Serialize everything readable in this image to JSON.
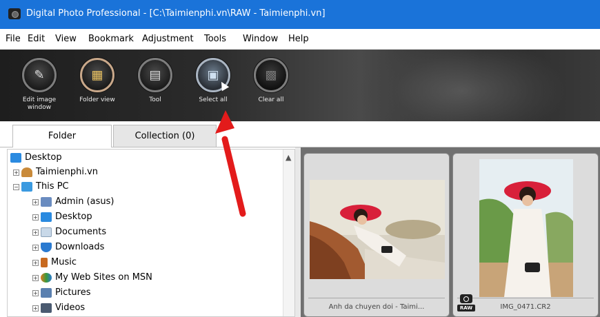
{
  "window": {
    "title": "Digital Photo Professional - [C:\\Taimienphi.vn\\RAW - Taimienphi.vn]"
  },
  "menu": [
    "File",
    "Edit",
    "View",
    "Bookmark",
    "Adjustment",
    "Tools",
    "Window",
    "Help"
  ],
  "toolbar": {
    "buttons": [
      {
        "label": "Edit image window",
        "icon": "edit-image-icon"
      },
      {
        "label": "Folder view",
        "icon": "folder-view-icon"
      },
      {
        "label": "Tool",
        "icon": "tool-palette-icon"
      },
      {
        "label": "Select all",
        "icon": "select-all-icon"
      },
      {
        "label": "Clear all",
        "icon": "clear-all-icon"
      }
    ]
  },
  "tabs": {
    "folder": "Folder",
    "collection": "Collection (0)"
  },
  "tree": [
    {
      "label": "Desktop",
      "icon": "desktop-icon",
      "color": "#2a8ae0"
    },
    {
      "label": "Taimienphi.vn",
      "icon": "user-folder-icon",
      "color": "#c98a3a"
    },
    {
      "label": "This PC",
      "icon": "computer-icon",
      "color": "#3a9ae0"
    },
    {
      "label": "Admin (asus)",
      "icon": "network-drive-icon",
      "color": "#6a8cc0"
    },
    {
      "label": "Desktop",
      "icon": "desktop-icon",
      "color": "#2a8ae0"
    },
    {
      "label": "Documents",
      "icon": "documents-icon",
      "color": "#9ab0c8"
    },
    {
      "label": "Downloads",
      "icon": "downloads-icon",
      "color": "#2a7ad0"
    },
    {
      "label": "Music",
      "icon": "music-icon",
      "color": "#c86a20"
    },
    {
      "label": "My Web Sites on MSN",
      "icon": "msn-icon",
      "color": "#e07a20"
    },
    {
      "label": "Pictures",
      "icon": "pictures-icon",
      "color": "#5a80b0"
    },
    {
      "label": "Videos",
      "icon": "videos-icon",
      "color": "#4a5a70"
    }
  ],
  "thumbnails": [
    {
      "caption": "Anh da chuyen doi - Taimi..."
    },
    {
      "caption": "IMG_0471.CR2",
      "badge": "RAW"
    }
  ]
}
